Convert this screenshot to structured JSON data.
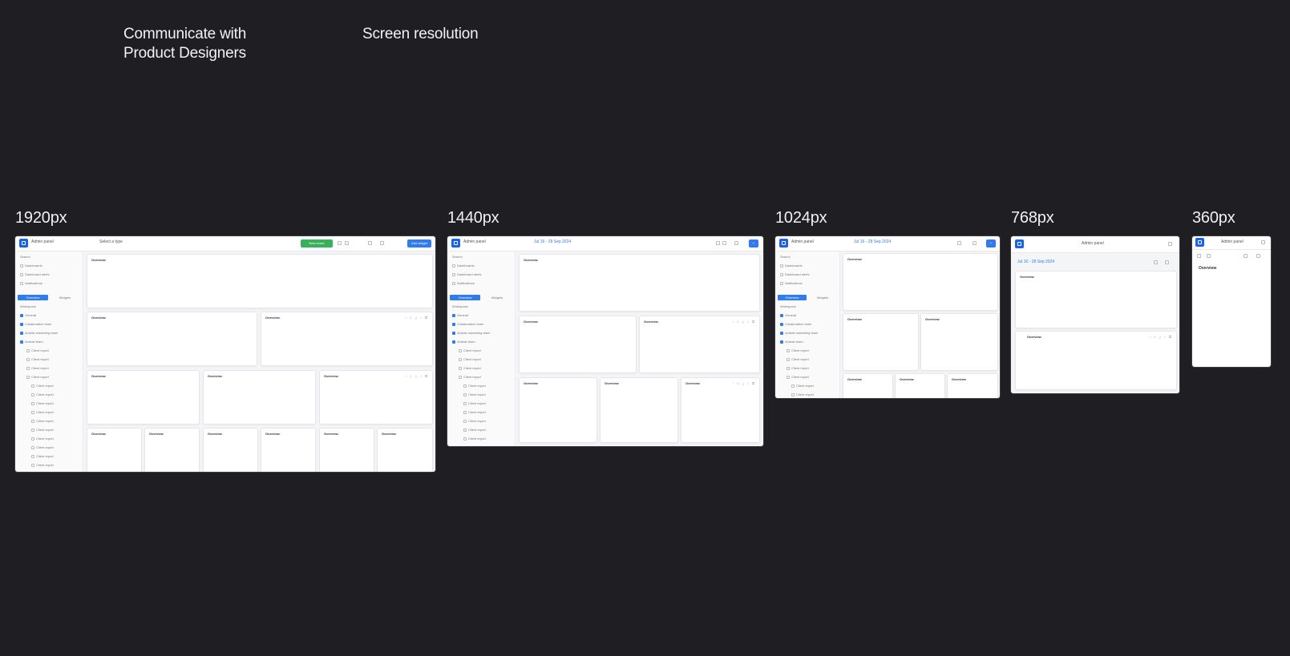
{
  "headings": {
    "left": [
      "Communicate with",
      "Product Designers"
    ],
    "right": "Screen resolution"
  },
  "resolutions": [
    "1920px",
    "1440px",
    "1024px",
    "768px",
    "360px"
  ],
  "app": {
    "brand": "Admin panel",
    "filter_label": "Select a type",
    "top_green_button": "New event",
    "top_blue_button": "Add widget",
    "date_range": "Jul 16 - 28 Sep 2024",
    "search_placeholder": "Search",
    "sidebar_top": [
      "Dashboards",
      "Dashboard alerts",
      "Notifications"
    ],
    "sidebar_tabs": [
      "Overview",
      "Widgets"
    ],
    "workspace_label": "Workspace",
    "workspace_items": [
      "General",
      "Collaborative team",
      "Activist marketing team",
      "Activist team"
    ],
    "report_label": "Client report",
    "card_title": "Overview",
    "card_icons": "○ ◇ △ ☆ ⧉"
  },
  "colors": {
    "background": "#1e1e23",
    "accent_blue": "#2f7cf0",
    "accent_green": "#36b35a",
    "card_border": "#e6e6ea"
  }
}
